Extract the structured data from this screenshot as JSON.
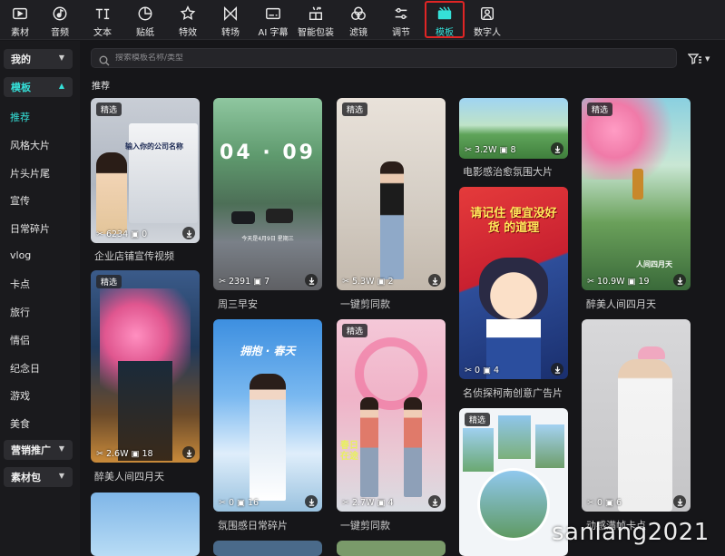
{
  "toolbar": {
    "items": [
      {
        "label": "素材",
        "icon": "media-icon"
      },
      {
        "label": "音频",
        "icon": "audio-icon"
      },
      {
        "label": "文本",
        "icon": "text-icon"
      },
      {
        "label": "贴纸",
        "icon": "sticker-icon"
      },
      {
        "label": "特效",
        "icon": "effects-icon"
      },
      {
        "label": "转场",
        "icon": "transition-icon"
      },
      {
        "label": "AI 字幕",
        "icon": "ai-caption-icon"
      },
      {
        "label": "智能包装",
        "icon": "smart-pack-icon"
      },
      {
        "label": "滤镜",
        "icon": "filter-icon"
      },
      {
        "label": "调节",
        "icon": "adjust-icon"
      },
      {
        "label": "模板",
        "icon": "template-icon",
        "active": true
      },
      {
        "label": "数字人",
        "icon": "digital-human-icon"
      }
    ],
    "active_color": "#35e0d8",
    "highlight_color": "#e02525"
  },
  "sidebar": {
    "groups": {
      "mine": "我的",
      "templates": "模板",
      "marketing": "营销推广",
      "packs": "素材包"
    },
    "items": [
      "推荐",
      "风格大片",
      "片头片尾",
      "宣传",
      "日常碎片",
      "vlog",
      "卡点",
      "旅行",
      "情侣",
      "纪念日",
      "游戏",
      "美食"
    ]
  },
  "search": {
    "placeholder": "搜索模板名称/类型"
  },
  "section_title": "推荐",
  "badge_label": "精选",
  "cards": {
    "c1": {
      "title": "企业店铺宣传视频",
      "uses": "6234",
      "clips": "0",
      "overlay": "输入你的公司名称"
    },
    "c2": {
      "title": "周三早安",
      "uses": "2391",
      "clips": "7",
      "overlay": "04 · 09",
      "sub": "今天是4月9日 星期三"
    },
    "c3": {
      "title": "一键剪同款",
      "uses": "5.3W",
      "clips": "2"
    },
    "c4": {
      "title": "电影感治愈氛围大片",
      "uses": "3.2W",
      "clips": "8"
    },
    "c5": {
      "title": "醉美人间四月天",
      "uses": "10.9W",
      "clips": "19",
      "overlay": "人间四月天"
    },
    "c6": {
      "title": "醉美人间四月天",
      "uses": "2.6W",
      "clips": "18"
    },
    "c7": {
      "title": "名侦探柯南创意广告片",
      "uses": "0",
      "clips": "4",
      "overlay": "请记住 便宜没好货 的道理"
    },
    "c8": {
      "title": "氛围感日常碎片",
      "uses": "0",
      "clips": "16",
      "overlay": "拥抱 · 春天"
    },
    "c9": {
      "title": "一键剪同款",
      "uses": "2.7W",
      "clips": "4",
      "overlay": "春日在途"
    },
    "c10": {
      "uses": "0",
      "clips": "6"
    },
    "c11": {},
    "c12": {
      "title": "动感满帧卡点"
    }
  },
  "watermark": "sanlang2021"
}
